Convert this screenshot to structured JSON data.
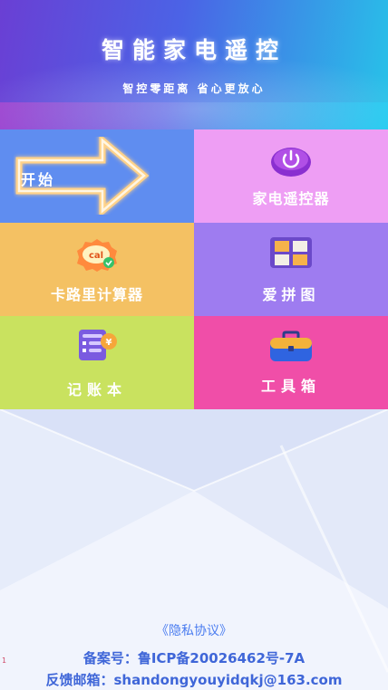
{
  "header": {
    "title": "智能家电遥控",
    "subtitle": "智控零距离 省心更放心"
  },
  "tiles": [
    {
      "label": "开始",
      "icon": "start-arrow-icon",
      "color": "#5f8df0"
    },
    {
      "label": "家电遥控器",
      "icon": "power-icon",
      "color": "#ee9ef4"
    },
    {
      "label": "卡路里计算器",
      "icon": "calorie-badge-icon",
      "color": "#f4c163"
    },
    {
      "label": "爱拼图",
      "icon": "puzzle-grid-icon",
      "color": "#9e7cf0"
    },
    {
      "label": "记账本",
      "icon": "ledger-icon",
      "color": "#c9e25f"
    },
    {
      "label": "工具箱",
      "icon": "toolbox-icon",
      "color": "#f04ea8"
    }
  ],
  "calorie_badge_text": "cal",
  "footer": {
    "privacy": "《隐私协议》",
    "record": "备案号：鲁ICP备20026462号-7A",
    "feedback": "反馈邮箱：shandongyouyidqkj@163.com",
    "marker": "1"
  }
}
